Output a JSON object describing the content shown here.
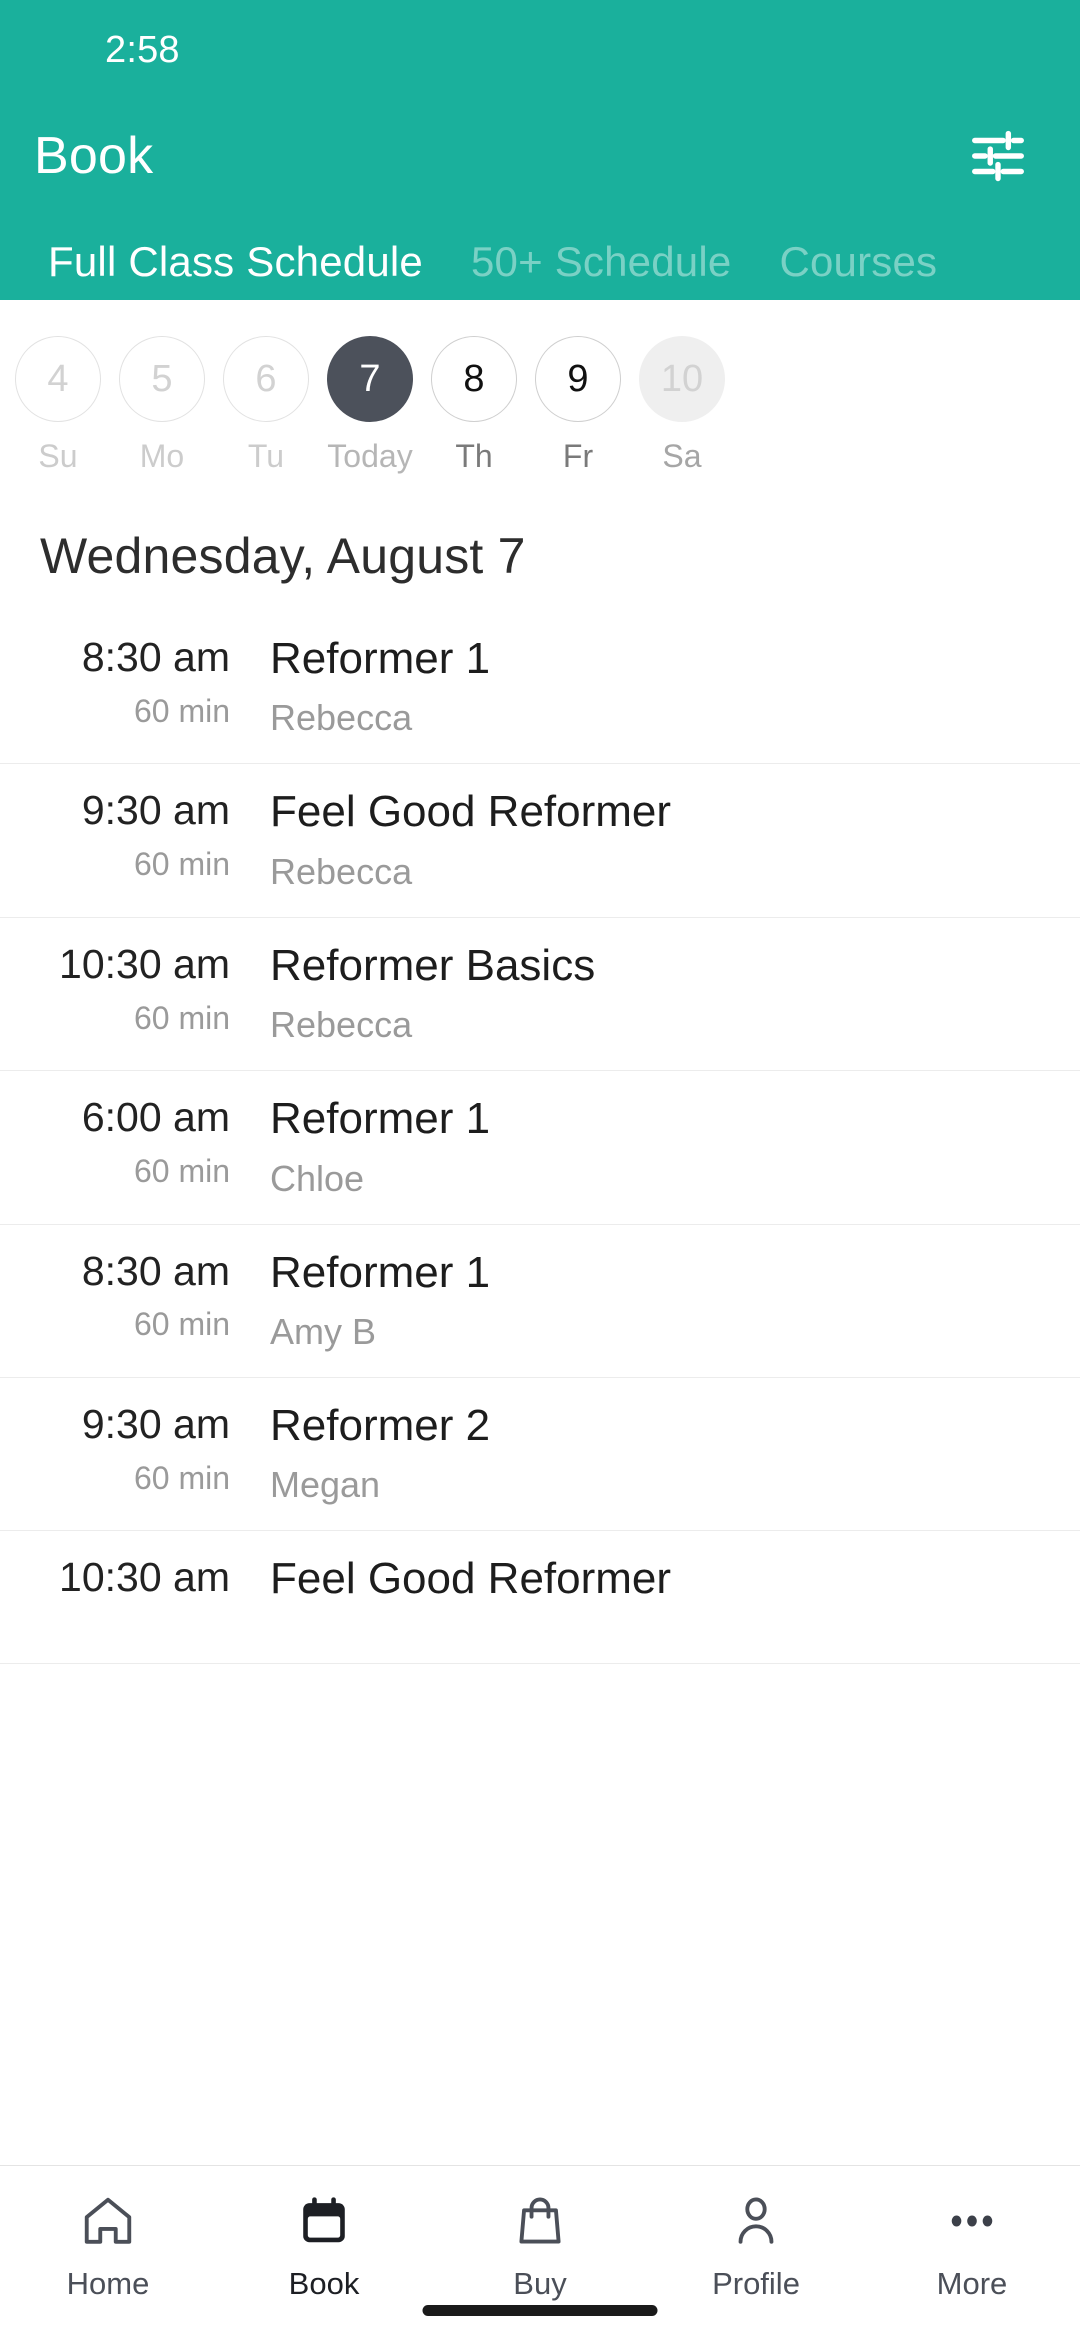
{
  "status_bar": {
    "clock": "2:58"
  },
  "header": {
    "title": "Book",
    "filter_icon": "tune-sliders-icon",
    "accent_color": "#1AB09C",
    "tabs": [
      {
        "label": "Full Class Schedule",
        "active": true
      },
      {
        "label": "50+ Schedule",
        "active": false
      },
      {
        "label": "Courses",
        "active": false
      }
    ]
  },
  "date_strip": {
    "days": [
      {
        "date": "4",
        "label": "Su",
        "state": "disabled"
      },
      {
        "date": "5",
        "label": "Mo",
        "state": "disabled"
      },
      {
        "date": "6",
        "label": "Tu",
        "state": "disabled"
      },
      {
        "date": "7",
        "label": "Today",
        "state": "selected"
      },
      {
        "date": "8",
        "label": "Th",
        "state": "enabled"
      },
      {
        "date": "9",
        "label": "Fr",
        "state": "enabled"
      },
      {
        "date": "10",
        "label": "Sa",
        "state": "placeholder"
      }
    ],
    "selected_color": "#4C515B"
  },
  "schedule": {
    "date_heading": "Wednesday, August 7",
    "classes": [
      {
        "time": "8:30 am",
        "duration": "60 min",
        "name": "Reformer 1",
        "teacher": "Rebecca"
      },
      {
        "time": "9:30 am",
        "duration": "60 min",
        "name": "Feel Good Reformer",
        "teacher": "Rebecca"
      },
      {
        "time": "10:30 am",
        "duration": "60 min",
        "name": "Reformer Basics",
        "teacher": "Rebecca"
      },
      {
        "time": "6:00 am",
        "duration": "60 min",
        "name": "Reformer 1",
        "teacher": "Chloe"
      },
      {
        "time": "8:30 am",
        "duration": "60 min",
        "name": "Reformer 1",
        "teacher": "Amy B"
      },
      {
        "time": "9:30 am",
        "duration": "60 min",
        "name": "Reformer 2",
        "teacher": "Megan"
      },
      {
        "time": "10:30 am",
        "duration": "",
        "name": "Feel Good Reformer",
        "teacher": ""
      }
    ]
  },
  "bottom_nav": {
    "items": [
      {
        "label": "Home",
        "icon": "home-icon",
        "active": false
      },
      {
        "label": "Book",
        "icon": "calendar-icon",
        "active": true
      },
      {
        "label": "Buy",
        "icon": "bag-icon",
        "active": false
      },
      {
        "label": "Profile",
        "icon": "person-icon",
        "active": false
      },
      {
        "label": "More",
        "icon": "ellipsis-icon",
        "active": false
      }
    ]
  }
}
